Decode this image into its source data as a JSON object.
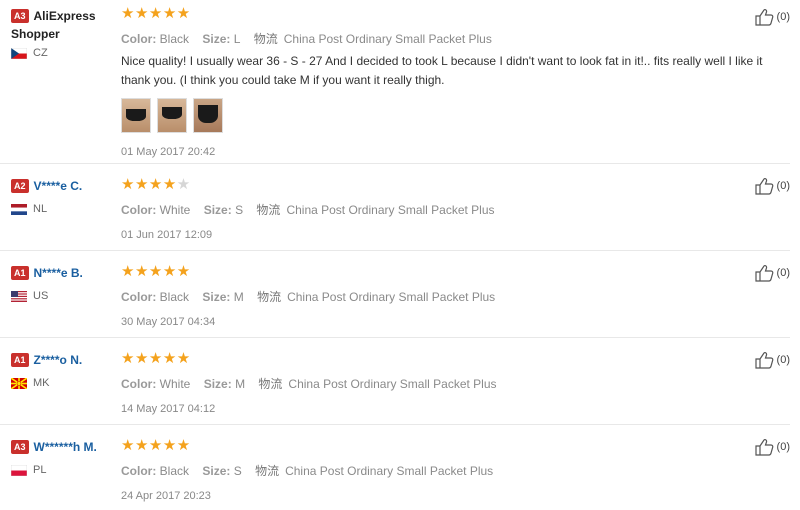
{
  "reviews": [
    {
      "badge": "A3",
      "name": "AliExpress Shopper",
      "country": "CZ",
      "stars": "★★★★★",
      "empty_stars": "",
      "color_label": "Color:",
      "color": "Black",
      "size_label": "Size:",
      "size": "L",
      "ship_label": "物流",
      "ship": "China Post Ordinary Small Packet Plus",
      "text": "Nice quality! I usually wear 36 - S - 27 And I decided to took L because I didn't want to look fat in it!.. fits really well I like it thank you. (I think you could take M if you want it really thigh.",
      "date": "01 May 2017 20:42",
      "helpful": "(0)"
    },
    {
      "badge": "A2",
      "name": "V****e C.",
      "country": "NL",
      "stars": "★★★★",
      "empty_stars": "★",
      "color_label": "Color:",
      "color": "White",
      "size_label": "Size:",
      "size": "S",
      "ship_label": "物流",
      "ship": "China Post Ordinary Small Packet Plus",
      "date": "01 Jun 2017 12:09",
      "helpful": "(0)"
    },
    {
      "badge": "A1",
      "name": "N****e B.",
      "country": "US",
      "stars": "★★★★★",
      "empty_stars": "",
      "color_label": "Color:",
      "color": "Black",
      "size_label": "Size:",
      "size": "M",
      "ship_label": "物流",
      "ship": "China Post Ordinary Small Packet Plus",
      "date": "30 May 2017 04:34",
      "helpful": "(0)"
    },
    {
      "badge": "A1",
      "name": "Z****o N.",
      "country": "MK",
      "stars": "★★★★★",
      "empty_stars": "",
      "color_label": "Color:",
      "color": "White",
      "size_label": "Size:",
      "size": "M",
      "ship_label": "物流",
      "ship": "China Post Ordinary Small Packet Plus",
      "date": "14 May 2017 04:12",
      "helpful": "(0)"
    },
    {
      "badge": "A3",
      "name": "W******h M.",
      "country": "PL",
      "stars": "★★★★★",
      "empty_stars": "",
      "color_label": "Color:",
      "color": "Black",
      "size_label": "Size:",
      "size": "S",
      "ship_label": "物流",
      "ship": "China Post Ordinary Small Packet Plus",
      "date": "24 Apr 2017 20:23",
      "helpful": "(0)"
    }
  ],
  "colors": {
    "badge": "#c9302c",
    "star": "#f4a21d",
    "name": "#1a5fa0"
  },
  "icons": {
    "helpful": "thumbs-up-icon",
    "flag": "country-flag-icon"
  }
}
